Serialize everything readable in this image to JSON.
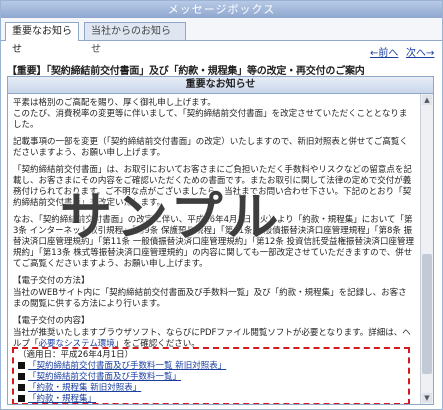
{
  "window": {
    "title": "メッセージボックス"
  },
  "tabs": [
    {
      "label": "重要なお知らせ",
      "active": true
    },
    {
      "label": "当社からのお知らせ",
      "active": false
    }
  ],
  "nav": {
    "prev": "←前へ",
    "next": "次へ→"
  },
  "notice": {
    "subject": "【重要】「契約締結前交付書面」及び「約款・規程集」等の改定・再交付のご案内",
    "box_title": "重要なお知らせ",
    "paragraphs": [
      "平素は格別のご高配を賜り、厚く御礼申し上げます。\nこのたび、消費税率の変更等に伴いまして、「契約締結前交付書面」を改定させていただくこととなりました。",
      "記載事項の一部を変更（「契約締結前交付書面」の改定）いたしますので、新旧対照表と併せてご高覧くださいますよう、お願い申し上げます。",
      "「契約締結前交付書面」は、お取引においてお客さまにご負担いただく手数料やリスクなどの留意点を記載し、お客さまにその内容をご確認いただくための書面です。またお取引に関して法律の定めで交付が義務付けられております。ご不明な点がございましたら、当社までお問い合わせ下さい。下記のとおり「契約締結前交付書面」を改定いたします。",
      "なお、「契約締結前交付書面」の改定に伴い、平成26年4月1日（火）より「約款・規程集」において「第3条 インターネット取引規程」「第9条 保護預り規程」「第11条 一般債振替決済口座管理規程」「第8条 振替決済口座管理規約」「第11条 一般債振替決済口座管理規約」「第12条 投資信託受益権振替決済口座管理規約」「第13条 株式等振替決済口座管理規約」の内容に関しても一部改定させていただきますので、併せてご高覧くださいますよう、お願い申し上げます。"
    ],
    "delivery_method_label": "【電子交付の方法】",
    "delivery_method_text": "当社のWEBサイト内に「契約締結前交付書面及び手数料一覧」及び「約款・規程集」を記録し、お客さまの閲覧に供する方法により行います。",
    "delivery_content_label": "【電子交付の内容】",
    "delivery_content_text": "当社が推奨いたしますブラウザソフト、ならびにPDFファイル閲覧ソフトが必要となります。詳細は、ヘルプ「",
    "system_link": "必要なシステム環境",
    "delivery_content_tail": "」をご確認ください。",
    "apply_date": "（適用日：平成26年4月1日）",
    "documents": [
      "「契約締結前交付書面及び手数料一覧 新旧対照表」",
      "「契約締結前交付書面及び手数料一覧」",
      "「約款・規程集 新旧対照表」",
      "「約款・規程集」"
    ]
  },
  "watermark": "サンプル",
  "colors": {
    "link": "#1a3fa0",
    "highlight_border": "#d6191c",
    "titlebar": "#8fa7cf"
  }
}
